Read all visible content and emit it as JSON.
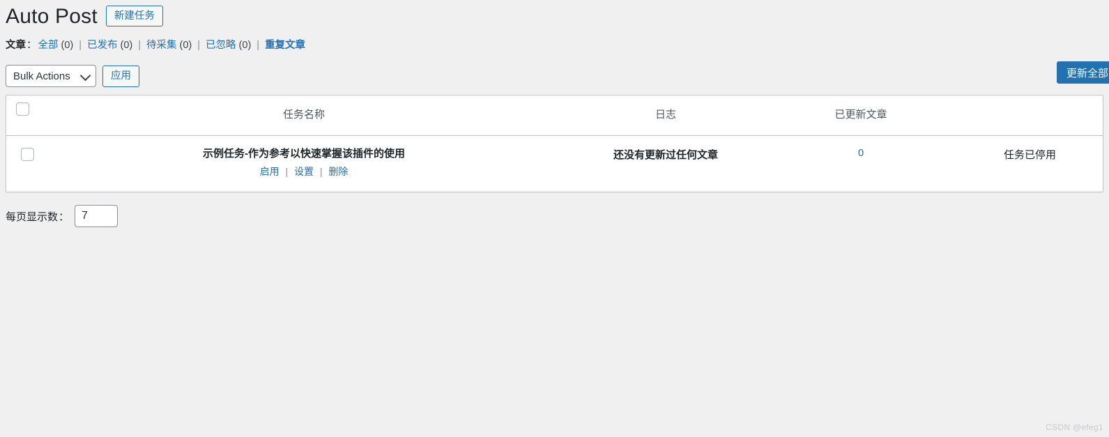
{
  "header": {
    "title": "Auto Post",
    "new_task_label": "新建任务"
  },
  "filters": {
    "label": "文章",
    "colon": "：",
    "separator": "|",
    "items": [
      {
        "label": "全部",
        "count": "(0)"
      },
      {
        "label": "已发布",
        "count": "(0)"
      },
      {
        "label": "待采集",
        "count": "(0)"
      },
      {
        "label": "已忽略",
        "count": "(0)"
      },
      {
        "label": "重复文章",
        "count": ""
      }
    ]
  },
  "tablenav": {
    "bulk_actions_label": "Bulk Actions",
    "bulk_actions_icon": "chevron-down-icon",
    "apply_label": "应用",
    "update_all_label": "更新全部"
  },
  "table": {
    "columns": {
      "task_name": "任务名称",
      "log": "日志",
      "updated_posts": "已更新文章"
    },
    "rows": [
      {
        "task_name": "示例任务-作为参考以快速掌握该插件的使用",
        "actions": [
          {
            "label": "启用"
          },
          {
            "label": "设置"
          },
          {
            "label": "删除"
          }
        ],
        "action_separator": "|",
        "log": "还没有更新过任何文章",
        "updated_posts": "0",
        "status": "任务已停用"
      }
    ]
  },
  "per_page": {
    "label": "每页显示数",
    "colon": "：",
    "value": "7"
  },
  "watermark": {
    "text": "CSDN @efeg1"
  },
  "colors": {
    "accent": "#2271b1",
    "page_background": "#f0f0f1",
    "text": "#1d2327",
    "border": "#c3c4c7"
  }
}
